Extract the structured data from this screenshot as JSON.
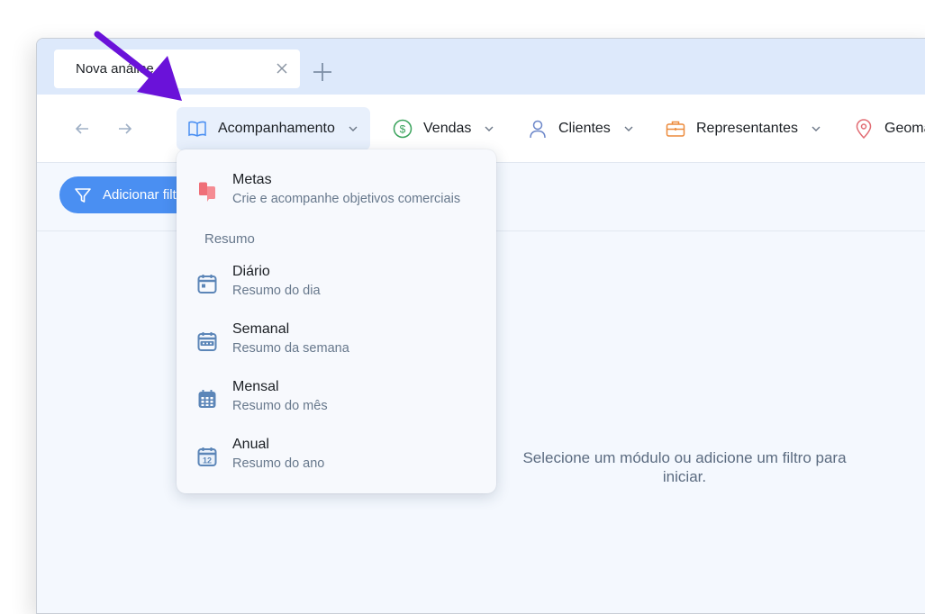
{
  "tab": {
    "title": "Nova análise"
  },
  "nav": {
    "back_icon": "arrow-left-icon",
    "forward_icon": "arrow-right-icon",
    "menus": [
      {
        "label": "Acompanhamento",
        "icon": "book-icon",
        "active": true
      },
      {
        "label": "Vendas",
        "icon": "dollar-circle-icon"
      },
      {
        "label": "Clientes",
        "icon": "user-icon"
      },
      {
        "label": "Representantes",
        "icon": "briefcase-icon"
      },
      {
        "label": "Geomarketing",
        "icon": "map-pin-icon"
      }
    ]
  },
  "filter": {
    "add_label": "Adicionar filtro"
  },
  "dropdown": {
    "items": [
      {
        "title": "Metas",
        "subtitle": "Crie e acompanhe objetivos comerciais",
        "icon": "flag-icon"
      }
    ],
    "section_label": "Resumo",
    "summary_items": [
      {
        "title": "Diário",
        "subtitle": "Resumo do dia",
        "icon": "calendar-day-icon"
      },
      {
        "title": "Semanal",
        "subtitle": "Resumo da semana",
        "icon": "calendar-week-icon"
      },
      {
        "title": "Mensal",
        "subtitle": "Resumo do mês",
        "icon": "calendar-month-icon"
      },
      {
        "title": "Anual",
        "subtitle": "Resumo do ano",
        "icon": "calendar-year-icon",
        "year_badge": "12"
      }
    ]
  },
  "empty_state": {
    "message": "Selecione um módulo ou adicione um filtro para iniciar."
  },
  "colors": {
    "accent": "#4a8ff2",
    "annotation_arrow": "#6a12d9",
    "flag": "#ef6f78",
    "vendas": "#3aa35c",
    "clientes": "#6b86c9",
    "representantes": "#ec8a3b",
    "geo": "#e26d74"
  }
}
